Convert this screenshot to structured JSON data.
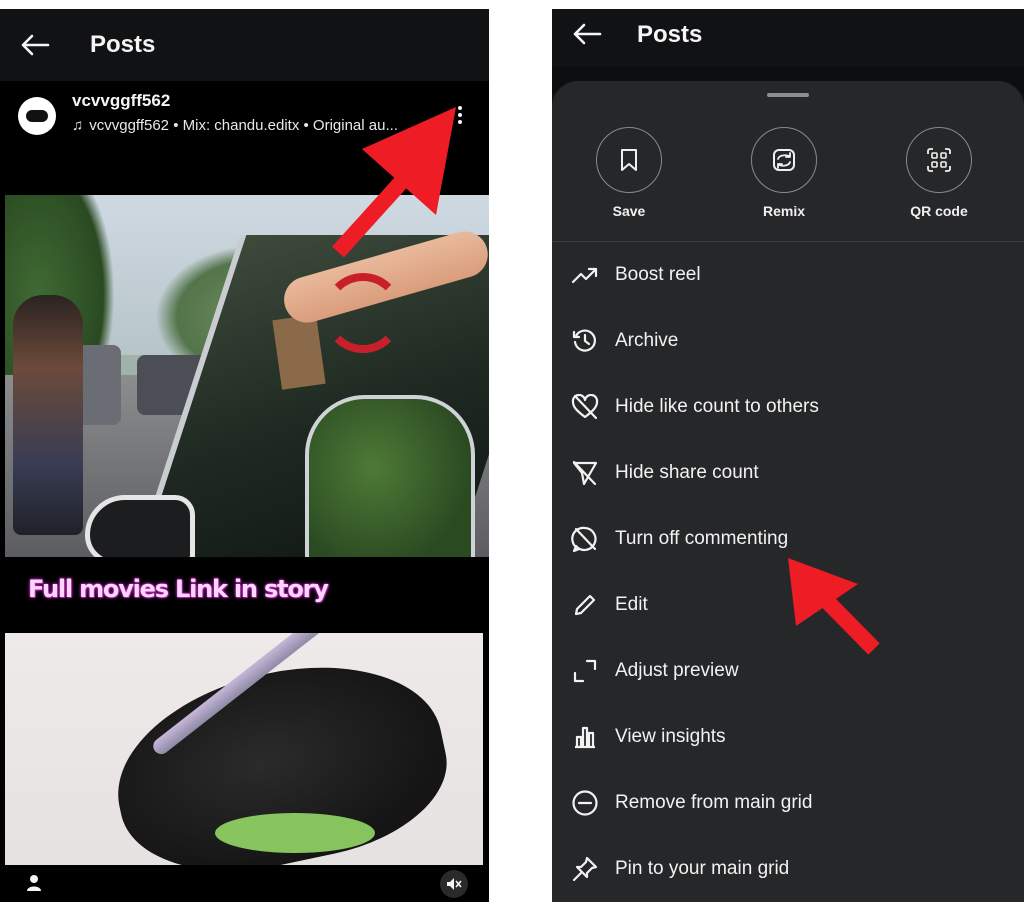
{
  "left_screen": {
    "header": {
      "title": "Posts"
    },
    "post": {
      "username": "vcvvggff562",
      "audio_text": "vcvvggff562 • Mix: chandu.editx • Original au...",
      "caption_overlay": "Full movies Link in story"
    },
    "icons": {
      "back": "back-arrow-icon",
      "more": "more-options-icon",
      "music": "music-note-icon",
      "person": "person-icon",
      "mute": "mute-icon"
    }
  },
  "right_screen": {
    "header": {
      "title": "Posts"
    },
    "quick_actions": [
      {
        "label": "Save",
        "icon": "bookmark-icon"
      },
      {
        "label": "Remix",
        "icon": "remix-icon"
      },
      {
        "label": "QR code",
        "icon": "qr-code-icon"
      }
    ],
    "menu": [
      {
        "label": "Boost reel",
        "icon": "trending-up-icon"
      },
      {
        "label": "Archive",
        "icon": "archive-history-icon"
      },
      {
        "label": "Hide like count to others",
        "icon": "heart-off-icon"
      },
      {
        "label": "Hide share count",
        "icon": "send-off-icon"
      },
      {
        "label": "Turn off commenting",
        "icon": "comment-off-icon"
      },
      {
        "label": "Edit",
        "icon": "pencil-icon"
      },
      {
        "label": "Adjust preview",
        "icon": "crop-corners-icon"
      },
      {
        "label": "View insights",
        "icon": "bar-chart-icon"
      },
      {
        "label": "Remove from main grid",
        "icon": "minus-circle-icon"
      },
      {
        "label": "Pin to your main grid",
        "icon": "pin-icon"
      }
    ]
  },
  "colors": {
    "annotation_arrow": "#ee1c24",
    "sheet_background": "#262729",
    "app_background": "#111214"
  }
}
